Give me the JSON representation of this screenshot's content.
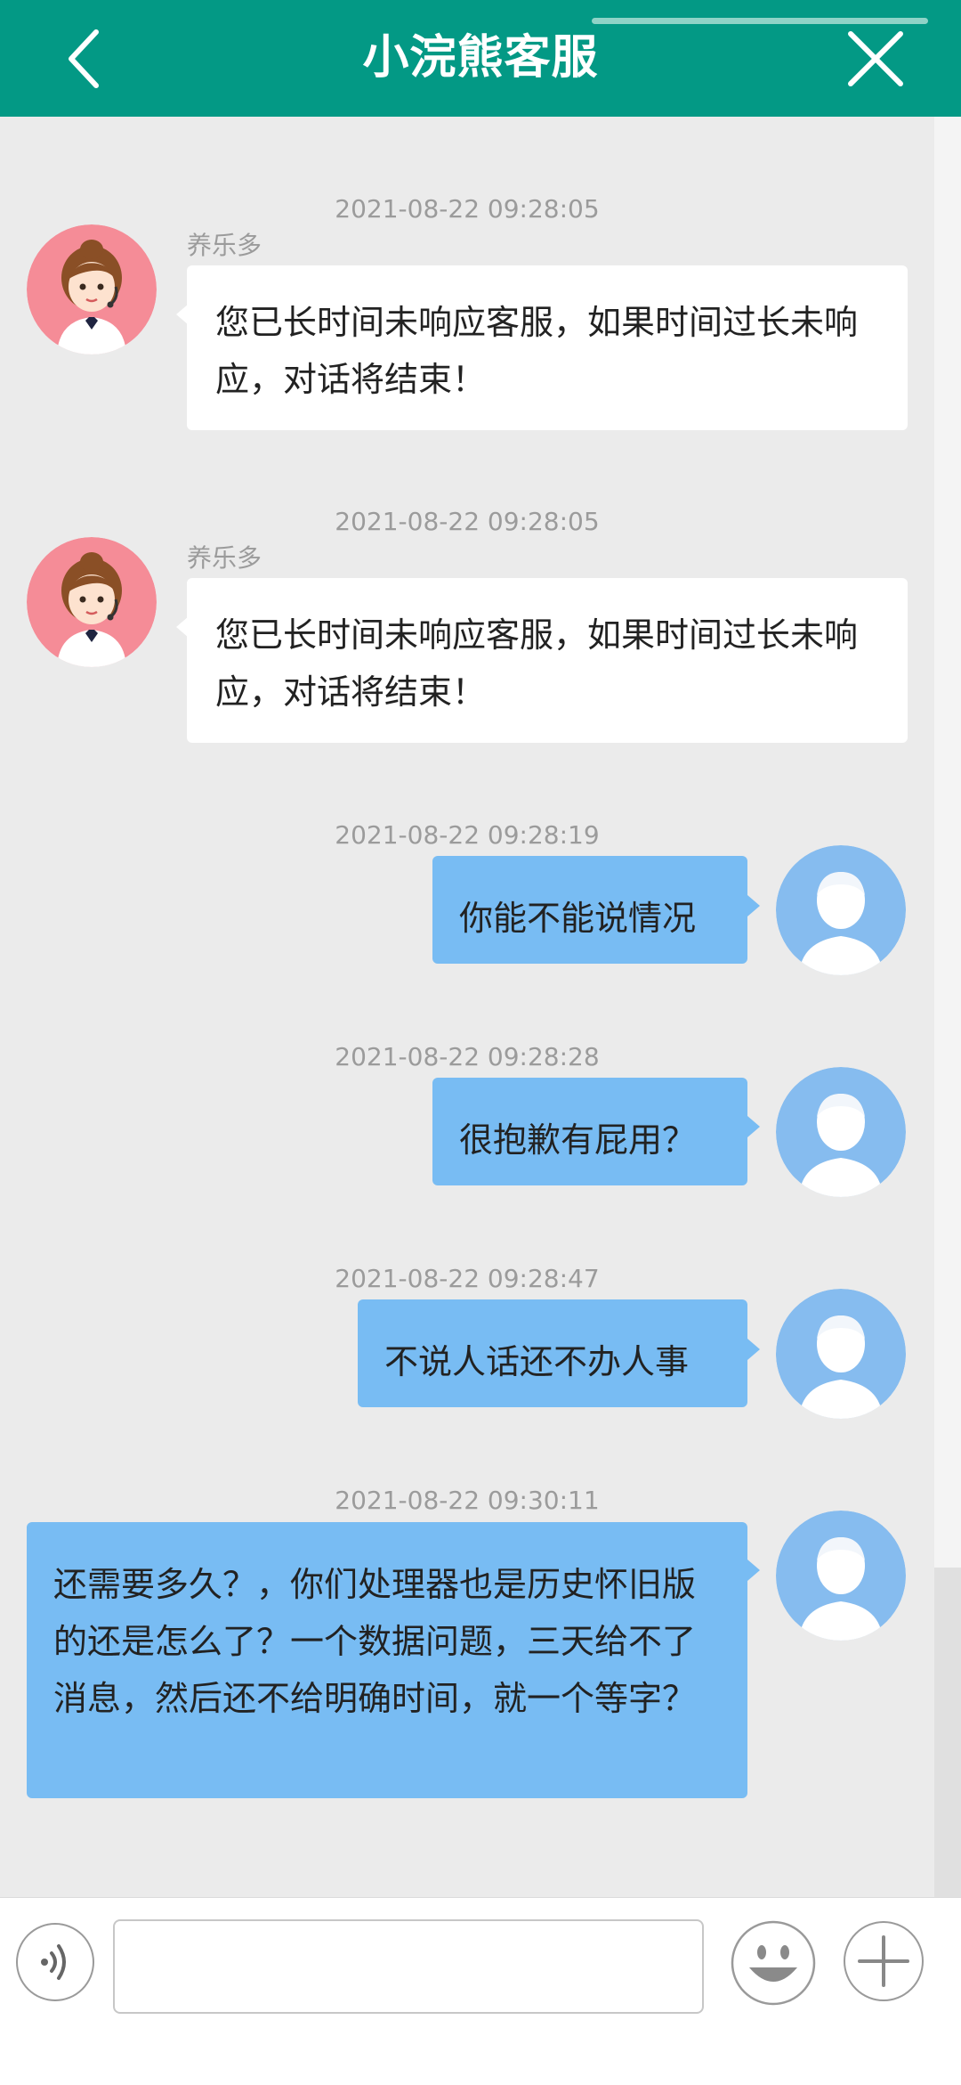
{
  "header": {
    "title": "小浣熊客服",
    "back_icon": "chevron-left-icon",
    "close_icon": "close-icon",
    "background": "#039985"
  },
  "messages": [
    {
      "timestamp": "2021-08-22 09:28:05",
      "sender": "养乐多",
      "direction": "in",
      "text": "您已长时间未响应客服，如果时间过长未响应，对话将结束！"
    },
    {
      "timestamp": "2021-08-22 09:28:05",
      "sender": "养乐多",
      "direction": "in",
      "text": "您已长时间未响应客服，如果时间过长未响应，对话将结束！"
    },
    {
      "timestamp": "2021-08-22 09:28:19",
      "direction": "out",
      "text": "你能不能说情况"
    },
    {
      "timestamp": "2021-08-22 09:28:28",
      "direction": "out",
      "text": "很抱歉有屁用？"
    },
    {
      "timestamp": "2021-08-22 09:28:47",
      "direction": "out",
      "text": "不说人话还不办人事"
    },
    {
      "timestamp": "2021-08-22 09:30:11",
      "direction": "out",
      "text": "还需要多久？，你们处理器也是历史怀旧版的还是怎么了？一个数据问题，三天给不了消息，然后还不给明确时间，就一个等字？"
    }
  ],
  "input": {
    "value": "",
    "placeholder": ""
  },
  "toolbar": {
    "voice_icon": "voice-icon",
    "emoji_icon": "emoji-icon",
    "plus_icon": "plus-icon"
  },
  "colors": {
    "incoming_bubble": "#ffffff",
    "outgoing_bubble": "#78bcf3",
    "chat_background": "#ebebeb"
  }
}
